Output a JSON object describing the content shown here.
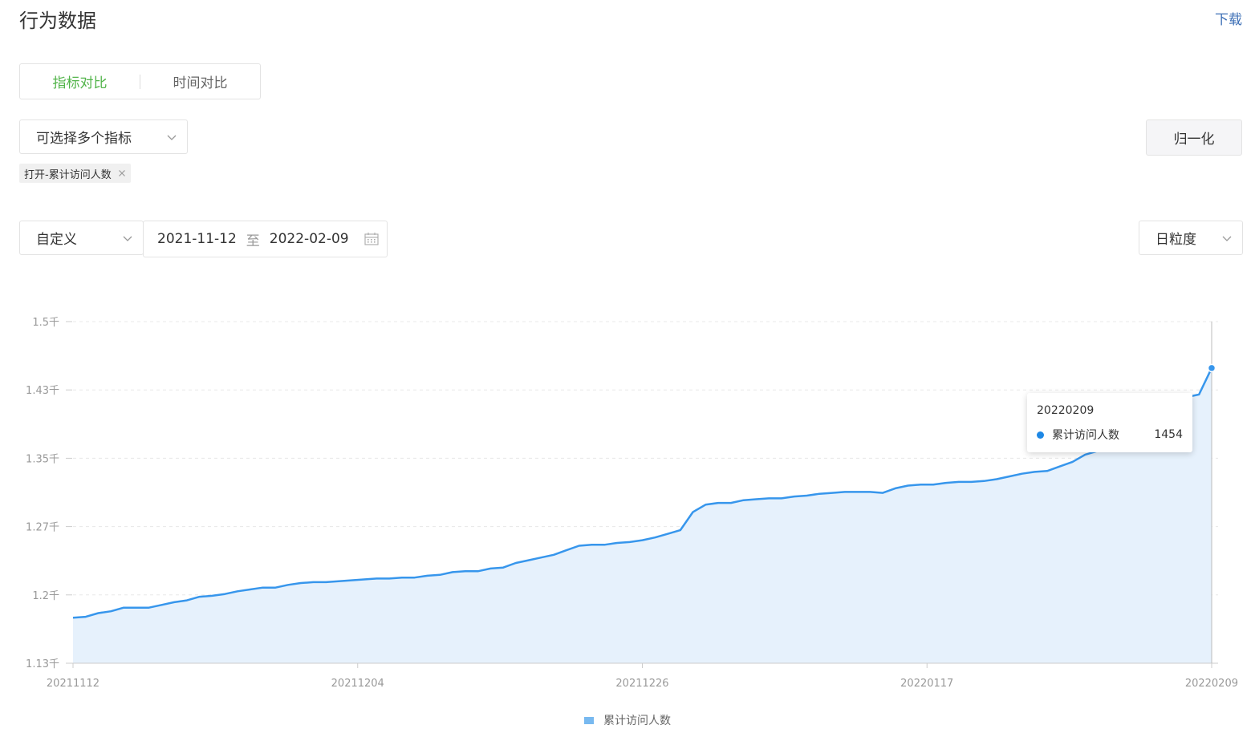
{
  "header": {
    "title": "行为数据",
    "download": "下载"
  },
  "compare_tabs": [
    {
      "label": "指标对比",
      "active": true
    },
    {
      "label": "时间对比",
      "active": false
    }
  ],
  "metric_select": {
    "label": "可选择多个指标"
  },
  "normalize_button": "归一化",
  "selected_tag": "打开-累计访问人数",
  "date_filter": {
    "mode": "自定义",
    "start": "2021-11-12",
    "to": "至",
    "end": "2022-02-09"
  },
  "granularity": "日粒度",
  "tooltip": {
    "date": "20220209",
    "series": "累计访问人数",
    "value": "1454"
  },
  "legend": {
    "label": "累计访问人数"
  },
  "colors": {
    "line": "#3796ec",
    "area": "#e6f1fc",
    "active_tab": "#52b44a",
    "link": "#3d6fb6"
  },
  "chart_data": {
    "type": "area",
    "y_ticks": [
      "1.13千",
      "1.2千",
      "1.27千",
      "1.35千",
      "1.43千",
      "1.5千"
    ],
    "y_tick_values": [
      1130,
      1205,
      1280,
      1355,
      1430,
      1505
    ],
    "x_ticks": [
      "20211112",
      "20211204",
      "20211226",
      "20220117",
      "20220209"
    ],
    "x_range": [
      "2021-11-12",
      "2022-02-09"
    ],
    "ylim": [
      1130,
      1505
    ],
    "grid": true,
    "legend_position": "bottom-center",
    "series": [
      {
        "name": "累计访问人数",
        "values": [
          1180,
          1181,
          1185,
          1187,
          1191,
          1191,
          1191,
          1194,
          1197,
          1199,
          1203,
          1204,
          1206,
          1209,
          1211,
          1213,
          1213,
          1216,
          1218,
          1219,
          1219,
          1220,
          1221,
          1222,
          1223,
          1223,
          1224,
          1224,
          1226,
          1227,
          1230,
          1231,
          1231,
          1234,
          1235,
          1240,
          1243,
          1246,
          1249,
          1254,
          1259,
          1260,
          1260,
          1262,
          1263,
          1265,
          1268,
          1272,
          1276,
          1296,
          1304,
          1306,
          1306,
          1309,
          1310,
          1311,
          1311,
          1313,
          1314,
          1316,
          1317,
          1318,
          1318,
          1318,
          1317,
          1322,
          1325,
          1326,
          1326,
          1328,
          1329,
          1329,
          1330,
          1332,
          1335,
          1338,
          1340,
          1341,
          1346,
          1351,
          1359,
          1363,
          1364,
          1365,
          1414,
          1415,
          1416,
          1417,
          1422,
          1425,
          1454
        ]
      }
    ]
  }
}
